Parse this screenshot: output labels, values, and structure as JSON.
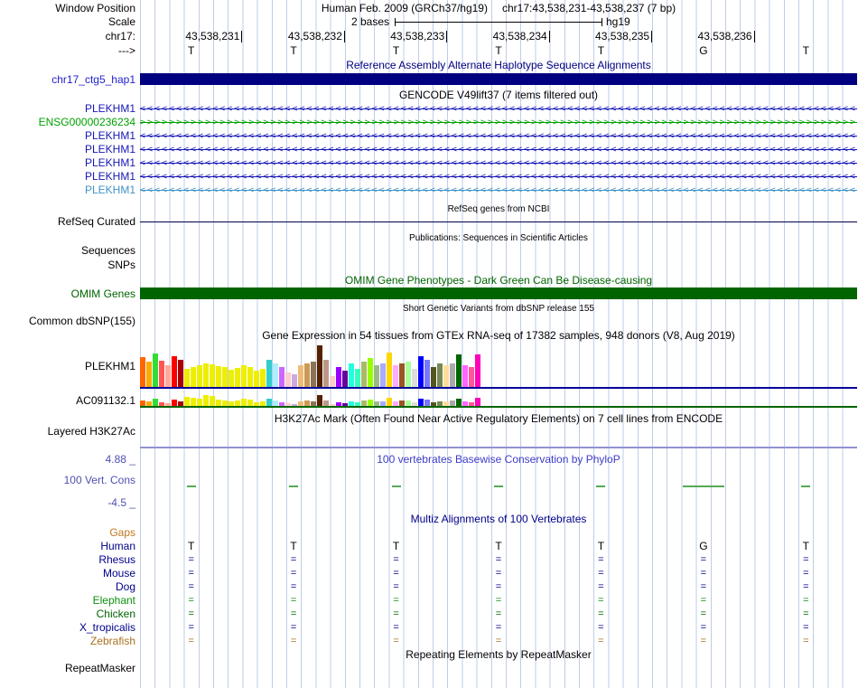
{
  "header": {
    "window_position_label": "Window Position",
    "assembly": "Human Feb. 2009 (GRCh37/hg19)",
    "position": "chr17:43,538,231-43,538,237 (7 bp)",
    "scale_label": "Scale",
    "scale_value": "2 bases",
    "genome": "hg19",
    "chrom": "chr17:",
    "strand": "--->"
  },
  "ruler": {
    "coordinates": [
      "43,538,231",
      "43,538,232",
      "43,538,233",
      "43,538,234",
      "43,538,235",
      "43,538,236"
    ],
    "bases": [
      "T",
      "T",
      "T",
      "T",
      "T",
      "G",
      "T"
    ]
  },
  "haplotype": {
    "title": "Reference Assembly Alternate Haplotype Sequence Alignments",
    "title_color": "#000080",
    "label": "chr17_ctg5_hap1",
    "label_color": "#2222CC",
    "bar_color": "#000080"
  },
  "gencode": {
    "title": "GENCODE V49lift37 (7 items filtered out)",
    "genes": [
      {
        "label": "PLEKHM1",
        "color": "#1616B6",
        "dir": "<"
      },
      {
        "label": "ENSG00000236234",
        "color": "#00A000",
        "dir": ">"
      },
      {
        "label": "PLEKHM1",
        "color": "#1616B6",
        "dir": "<"
      },
      {
        "label": "PLEKHM1",
        "color": "#1616B6",
        "dir": "<"
      },
      {
        "label": "PLEKHM1",
        "color": "#1616B6",
        "dir": "<"
      },
      {
        "label": "PLEKHM1",
        "color": "#1616B6",
        "dir": "<"
      },
      {
        "label": "PLEKHM1",
        "color": "#3F93C4",
        "dir": "<"
      }
    ]
  },
  "refseq": {
    "title": "RefSeq genes from NCBI",
    "label": "RefSeq Curated",
    "line_color": "#000050"
  },
  "publications": {
    "title": "Publications: Sequences in Scientific Articles",
    "sequences_label": "Sequences",
    "snps_label": "SNPs"
  },
  "omim": {
    "title": "OMIM Gene Phenotypes - Dark Green Can Be Disease-causing",
    "label": "OMIM Genes",
    "color": "#006400"
  },
  "dbsnp": {
    "title": "Short Genetic Variants from dbSNP release 155",
    "label": "Common dbSNP(155)"
  },
  "gtex": {
    "title": "Gene Expression in 54 tissues from GTEx RNA-seq of 17382 samples, 948 donors (V8, Aug 2019)",
    "tissue_colors": [
      "#FF6600",
      "#FFAA00",
      "#33DD33",
      "#FF5555",
      "#FFAA99",
      "#FF0000",
      "#AA0000",
      "#EEEE00",
      "#EEEE00",
      "#EEEE00",
      "#EEEE00",
      "#EEEE00",
      "#EEEE00",
      "#EEEE00",
      "#EEEE00",
      "#EEEE00",
      "#EEEE00",
      "#EEEE00",
      "#EEEE00",
      "#EEEE00",
      "#33CCCC",
      "#AAEEFF",
      "#CC66FF",
      "#FFCCCC",
      "#CCAADD",
      "#EEBB77",
      "#CC9955",
      "#8B7355",
      "#552200",
      "#BB9988",
      "#FFCCCC",
      "#9900FF",
      "#660099",
      "#22FFDD",
      "#33FFC2",
      "#AABB66",
      "#99FF00",
      "#99BB88",
      "#AAAAFF",
      "#FFD700",
      "#FFAAFF",
      "#995522",
      "#AAFF99",
      "#DDDDDD",
      "#0000FF",
      "#7777FF",
      "#555522",
      "#778855",
      "#FFDD99",
      "#AAAAAA",
      "#006600",
      "#FF66FF",
      "#FF5599",
      "#FF00BB"
    ],
    "tracks": [
      {
        "label": "PLEKHM1",
        "baseline_color": "#000099",
        "heights": [
          33,
          28,
          37,
          29,
          24,
          34,
          30,
          20,
          22,
          24,
          26,
          25,
          23,
          22,
          19,
          21,
          24,
          22,
          18,
          20,
          30,
          26,
          22,
          16,
          14,
          24,
          26,
          28,
          46,
          30,
          12,
          22,
          18,
          26,
          20,
          28,
          32,
          24,
          26,
          38,
          24,
          26,
          28,
          20,
          34,
          30,
          22,
          26,
          24,
          26,
          36,
          24,
          22,
          36
        ]
      },
      {
        "label": "AC091132.1",
        "baseline_color": "#006400",
        "heights": [
          6,
          5,
          8,
          4,
          3,
          7,
          5,
          10,
          9,
          8,
          12,
          11,
          7,
          6,
          5,
          6,
          8,
          7,
          4,
          5,
          8,
          6,
          4,
          3,
          2,
          5,
          6,
          5,
          12,
          6,
          2,
          4,
          3,
          5,
          4,
          6,
          7,
          5,
          5,
          9,
          5,
          6,
          6,
          4,
          8,
          7,
          4,
          5,
          5,
          6,
          8,
          5,
          4,
          9
        ]
      }
    ]
  },
  "h3k27ac": {
    "title": "H3K27Ac Mark (Often Found Near Active Regulatory Elements) on 7 cell lines from ENCODE",
    "label": "Layered H3K27Ac",
    "line_color": "#9191D1"
  },
  "conservation": {
    "title": "100 vertebrates Basewise Conservation by PhyloP",
    "title_color": "#3C3CC8",
    "label": "100 Vert. Cons",
    "label_color": "#5050B4",
    "max_label": "4.88 _",
    "min_label": "-4.5 _",
    "dash_color": "#55AA55",
    "dash_widths": [
      10,
      10,
      10,
      10,
      10,
      46,
      10
    ]
  },
  "multiz": {
    "title": "Multiz Alignments of 100 Vertebrates",
    "title_color": "#00008B",
    "rows": [
      {
        "label": "Gaps",
        "color": "#C07820",
        "type": "none"
      },
      {
        "label": "Human",
        "color": "#00008B",
        "type": "seq",
        "seq": [
          "T",
          "T",
          "T",
          "T",
          "T",
          "G",
          "T"
        ],
        "seq_color": "#000000"
      },
      {
        "label": "Rhesus",
        "color": "#00008B",
        "type": "eq"
      },
      {
        "label": "Mouse",
        "color": "#00008B",
        "type": "eq"
      },
      {
        "label": "Dog",
        "color": "#00008B",
        "type": "eq"
      },
      {
        "label": "Elephant",
        "color": "#0F8F0F",
        "type": "eq"
      },
      {
        "label": "Chicken",
        "color": "#006400",
        "type": "eq"
      },
      {
        "label": "X_tropicalis",
        "color": "#00008B",
        "type": "eq"
      },
      {
        "label": "Zebrafish",
        "color": "#A8701E",
        "type": "eq"
      }
    ]
  },
  "repeatmasker": {
    "title": "Repeating Elements by RepeatMasker",
    "label": "RepeatMasker"
  }
}
